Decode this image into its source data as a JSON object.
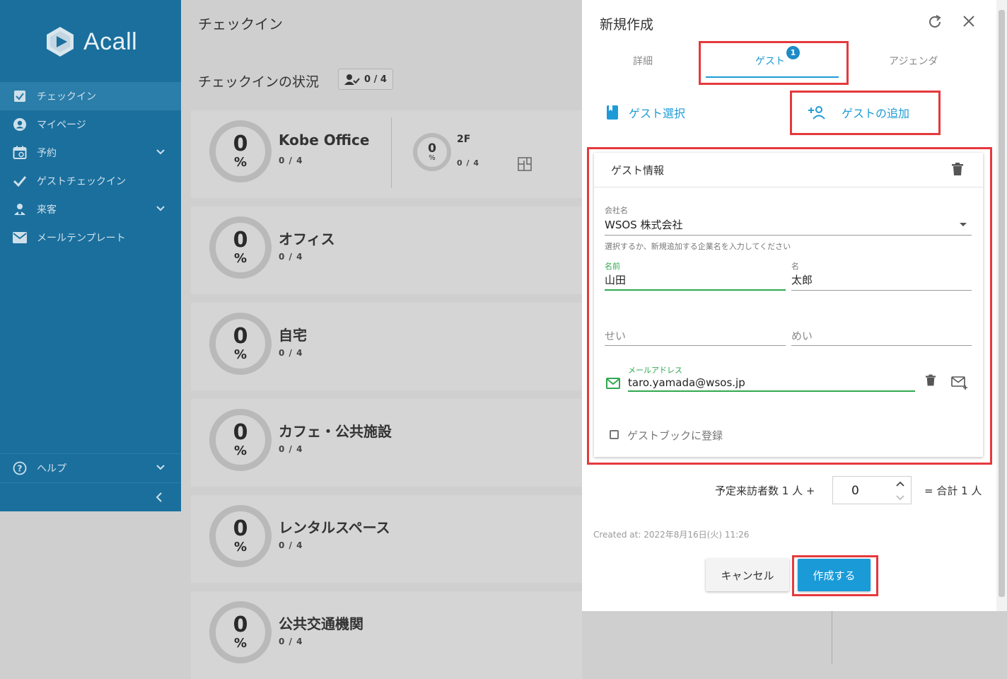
{
  "sidebar": {
    "logo_text": "Acall",
    "items": [
      {
        "label": "チェックイン",
        "icon": "checkbox-icon"
      },
      {
        "label": "マイページ",
        "icon": "account-icon"
      },
      {
        "label": "予約",
        "icon": "calendar-icon"
      },
      {
        "label": "ゲストチェックイン",
        "icon": "check-icon"
      },
      {
        "label": "来客",
        "icon": "visitor-icon"
      },
      {
        "label": "メールテンプレート",
        "icon": "mail-icon"
      }
    ],
    "help_label": "ヘルプ",
    "collapse_icon": "chevron-left-icon"
  },
  "main": {
    "title": "チェックイン",
    "status_label": "チェックインの状況",
    "status_badge": "0 / 4",
    "cards": [
      {
        "name": "Kobe Office",
        "percent": "0",
        "unit": "%",
        "count": "0 / 4"
      },
      {
        "name": "オフィス",
        "percent": "0",
        "unit": "%",
        "count": "0 / 4"
      },
      {
        "name": "自宅",
        "percent": "0",
        "unit": "%",
        "count": "0 / 4"
      },
      {
        "name": "カフェ・公共施設",
        "percent": "0",
        "unit": "%",
        "count": "0 / 4"
      },
      {
        "name": "レンタルスペース",
        "percent": "0",
        "unit": "%",
        "count": "0 / 4"
      },
      {
        "name": "公共交通機関",
        "percent": "0",
        "unit": "%",
        "count": "0 / 4"
      }
    ],
    "floor": {
      "label": "2F",
      "percent": "0",
      "unit": "%",
      "count": "0 / 4"
    }
  },
  "dialog": {
    "title": "新規作成",
    "tabs": [
      {
        "label": "詳細"
      },
      {
        "label": "ゲスト",
        "badge": "1"
      },
      {
        "label": "アジェンダ"
      }
    ],
    "guest_select_label": "ゲスト選択",
    "add_guest_label": "ゲストの追加",
    "guest_info": {
      "title": "ゲスト情報",
      "company_label": "会社名",
      "company_value": "WSOS 株式会社",
      "company_hint": "選択するか、新規追加する企業名を入力してください",
      "last_name_label": "名前",
      "last_name_value": "山田",
      "first_name_label": "名",
      "first_name_value": "太郎",
      "last_kana_placeholder": "せい",
      "first_kana_placeholder": "めい",
      "email_label": "メールアドレス",
      "email_value": "taro.yamada@wsos.jp",
      "guestbook_label": "ゲストブックに登録"
    },
    "visitors_label": "予定来訪者数 1 人 +",
    "visitors_value": "0",
    "visitors_total": "= 合計 1 人",
    "created_at": "Created at: 2022年8月16日(火) 11:26",
    "cancel_label": "キャンセル",
    "create_label": "作成する"
  },
  "colors": {
    "sidebar": "#1a6f9d",
    "accent": "#1e9bd7",
    "green": "#2fa84f",
    "highlight": "#e5393c"
  }
}
